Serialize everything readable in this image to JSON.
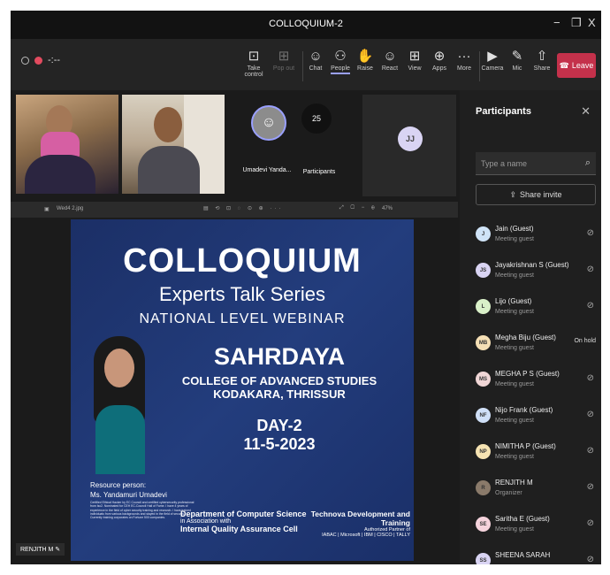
{
  "window": {
    "title": "COLLOQUIUM-2",
    "minimize": "−",
    "maximize": "❐",
    "close": "X"
  },
  "toolbar": {
    "timer": "-:--",
    "buttons": [
      {
        "label": "Take control",
        "icon": "⊡"
      },
      {
        "label": "Pop out",
        "icon": "⊞"
      },
      {
        "label": "Chat",
        "icon": "☺"
      },
      {
        "label": "People",
        "icon": "⚇"
      },
      {
        "label": "Raise",
        "icon": "✋"
      },
      {
        "label": "React",
        "icon": "☺"
      },
      {
        "label": "View",
        "icon": "⊞"
      },
      {
        "label": "Apps",
        "icon": "⊕"
      },
      {
        "label": "More",
        "icon": "···"
      },
      {
        "label": "Camera",
        "icon": "▶"
      },
      {
        "label": "Mic",
        "icon": "✎"
      },
      {
        "label": "Share",
        "icon": "⇧"
      }
    ],
    "leave_label": "Leave",
    "leave_icon": "☎"
  },
  "tiles": {
    "umadevi_name": "Umadevi Yanda...",
    "participants_count": "25",
    "participants_label": "Participants",
    "jj_initials": "JJ"
  },
  "presentation": {
    "filename": "Wed4 2.jpg",
    "zoom": "47%",
    "slide": {
      "title": "COLLOQUIUM",
      "subtitle": "Experts Talk Series",
      "tagline": "NATIONAL LEVEL WEBINAR",
      "org": "SAHRDAYA",
      "org_line2": "COLLEGE OF ADVANCED STUDIES",
      "org_line3": "KODAKARA, THRISSUR",
      "day": "DAY-2",
      "date": "11-5-2023",
      "resource_label": "Resource person:",
      "resource_name": "Ms. Yandamuri Umadevi",
      "resource_bio": "Certified Ethical Hacker by EC Council and certified cybersecurity professional from Isc2. Nominated for CEH EC-Council Hall of Fame. I have 4 years of experience in the field of cyber security training and research. I have trained individuals from various backgrounds and stayed in the field of security. Currently training corporates on Fortune 500 companies.",
      "dept_line1": "Department of Computer Science",
      "dept_line2": "in Association with",
      "dept_line3": "Internal Quality Assurance Cell",
      "partner_line1": "Technova Development and",
      "partner_line2": "Training",
      "partner_line3": "Authorized Partner of",
      "partner_line4": "IABAC | Microsoft | IBM | CISCO | TALLY"
    }
  },
  "presenter_badge": "RENJITH M",
  "panel": {
    "title": "Participants",
    "search_placeholder": "Type a name",
    "share_invite": "Share invite",
    "participants": [
      {
        "initials": "J",
        "name": "Jain (Guest)",
        "role": "Meeting guest",
        "status": "",
        "color": "#cfe3f7"
      },
      {
        "initials": "JS",
        "name": "Jayakrishnan S (Guest)",
        "role": "Meeting guest",
        "status": "",
        "color": "#d9d4f3"
      },
      {
        "initials": "L",
        "name": "Lijo (Guest)",
        "role": "Meeting guest",
        "status": "",
        "color": "#d9f0c8"
      },
      {
        "initials": "MB",
        "name": "Megha Biju (Guest)",
        "role": "Meeting guest",
        "status": "On hold",
        "color": "#f5dfb5"
      },
      {
        "initials": "MS",
        "name": "MEGHA P S (Guest)",
        "role": "Meeting guest",
        "status": "",
        "color": "#f0d6d6"
      },
      {
        "initials": "NF",
        "name": "Nijo Frank (Guest)",
        "role": "Meeting guest",
        "status": "",
        "color": "#cfdff7"
      },
      {
        "initials": "NP",
        "name": "NIMITHA P (Guest)",
        "role": "Meeting guest",
        "status": "",
        "color": "#f6e3b2"
      },
      {
        "initials": "R",
        "name": "RENJITH M",
        "role": "Organizer",
        "status": "",
        "color": "#8a7a6a"
      },
      {
        "initials": "SE",
        "name": "Saritha E (Guest)",
        "role": "Meeting guest",
        "status": "",
        "color": "#f5d3dc"
      },
      {
        "initials": "SS",
        "name": "SHEENA SARAH",
        "role": "",
        "status": "",
        "color": "#d9d4f3"
      }
    ]
  }
}
